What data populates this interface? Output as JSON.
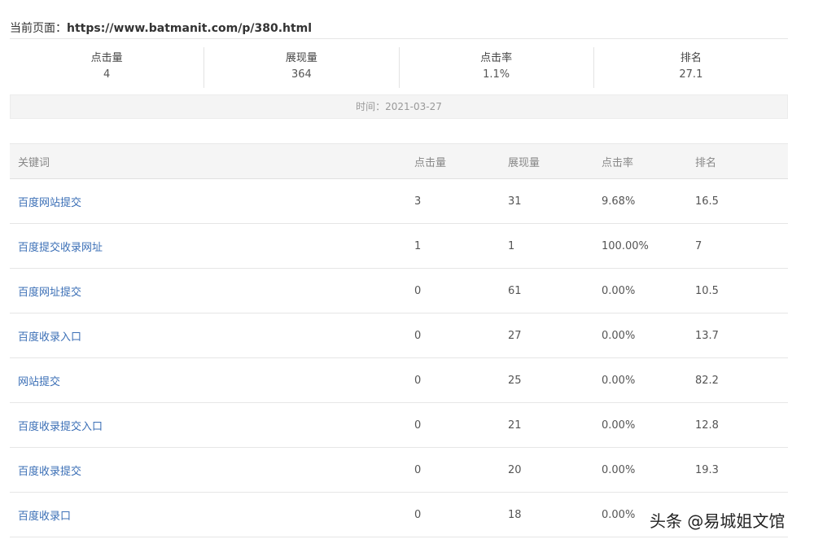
{
  "page": {
    "label": "当前页面：",
    "url": "https://www.batmanit.com/p/380.html"
  },
  "summary": [
    {
      "label": "点击量",
      "value": "4"
    },
    {
      "label": "展现量",
      "value": "364"
    },
    {
      "label": "点击率",
      "value": "1.1%"
    },
    {
      "label": "排名",
      "value": "27.1"
    }
  ],
  "time_bar": "时间：2021-03-27",
  "table": {
    "headers": {
      "keyword": "关键词",
      "clicks": "点击量",
      "impressions": "展现量",
      "ctr": "点击率",
      "rank": "排名"
    },
    "rows": [
      {
        "keyword": "百度网站提交",
        "clicks": "3",
        "impressions": "31",
        "ctr": "9.68%",
        "rank": "16.5"
      },
      {
        "keyword": "百度提交收录网址",
        "clicks": "1",
        "impressions": "1",
        "ctr": "100.00%",
        "rank": "7"
      },
      {
        "keyword": "百度网址提交",
        "clicks": "0",
        "impressions": "61",
        "ctr": "0.00%",
        "rank": "10.5"
      },
      {
        "keyword": "百度收录入口",
        "clicks": "0",
        "impressions": "27",
        "ctr": "0.00%",
        "rank": "13.7"
      },
      {
        "keyword": "网站提交",
        "clicks": "0",
        "impressions": "25",
        "ctr": "0.00%",
        "rank": "82.2"
      },
      {
        "keyword": "百度收录提交入口",
        "clicks": "0",
        "impressions": "21",
        "ctr": "0.00%",
        "rank": "12.8"
      },
      {
        "keyword": "百度收录提交",
        "clicks": "0",
        "impressions": "20",
        "ctr": "0.00%",
        "rank": "19.3"
      },
      {
        "keyword": "百度收录口",
        "clicks": "0",
        "impressions": "18",
        "ctr": "0.00%",
        "rank": ""
      }
    ]
  },
  "watermark": "头条 @易城姐文馆"
}
